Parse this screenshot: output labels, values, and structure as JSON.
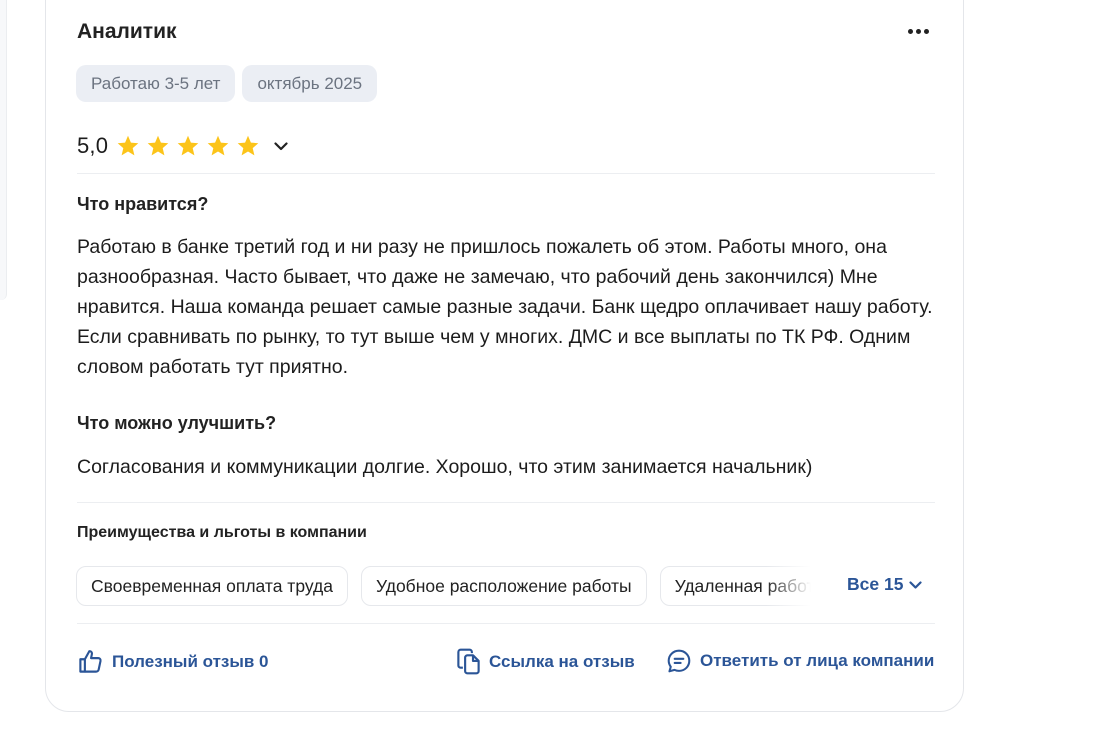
{
  "review": {
    "title": "Аналитик",
    "tags": [
      "Работаю 3-5 лет",
      "октябрь 2025"
    ],
    "rating": {
      "value": "5,0",
      "stars": 5,
      "max_stars": 5,
      "star_color": "#fcc419"
    },
    "likes": {
      "heading": "Что нравится?",
      "text": "Работаю в банке третий год и ни разу не пришлось пожалеть об этом. Работы много, она разнообразная. Часто бывает, что даже не замечаю, что рабочий день закончился) Мне нравится. Наша команда решает самые разные задачи. Банк щедро оплачивает нашу работу. Если сравнивать по рынку, то тут выше чем у многих. ДМС и все выплаты по ТК РФ. Одним словом работать тут приятно."
    },
    "improve": {
      "heading": "Что можно улучшить?",
      "text": "Согласования и коммуникации долгие. Хорошо, что этим занимается начальник)"
    },
    "benefits": {
      "heading": "Преимущества и льготы в компании",
      "items": [
        "Своевременная оплата труда",
        "Удобное расположение работы",
        "Удаленная работа"
      ],
      "all_label": "Все 15"
    },
    "actions": {
      "helpful": "Полезный отзыв 0",
      "link": "Ссылка на отзыв",
      "reply": "Ответить от лица компании"
    }
  },
  "colors": {
    "accent": "#2b5597",
    "chip_bg": "#ebeef4",
    "chip_text": "#6b7380"
  },
  "icons": [
    "more-icon",
    "star-icon",
    "chevron-down-icon",
    "thumbs-up-icon",
    "copy-icon",
    "comment-icon"
  ]
}
